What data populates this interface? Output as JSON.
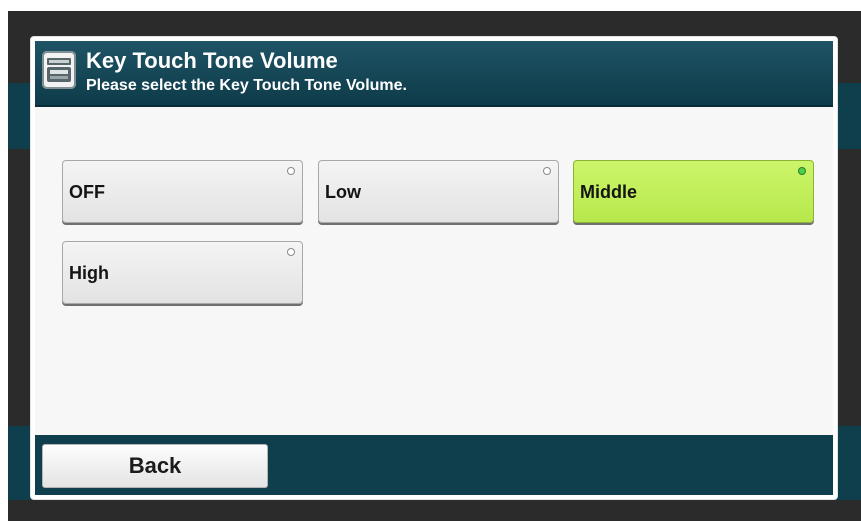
{
  "dialog": {
    "title": "Key Touch Tone Volume",
    "subtitle": "Please select the Key Touch Tone Volume.",
    "icon": "printer-panel-icon"
  },
  "options": [
    {
      "label": "OFF",
      "selected": false
    },
    {
      "label": "Low",
      "selected": false
    },
    {
      "label": "Middle",
      "selected": true
    },
    {
      "label": "High",
      "selected": false
    }
  ],
  "footer": {
    "back_label": "Back"
  },
  "colors": {
    "title_bar": "#0e3b49",
    "selected_option": "#c2f05a",
    "indicator_selected": "#4bd04b"
  }
}
